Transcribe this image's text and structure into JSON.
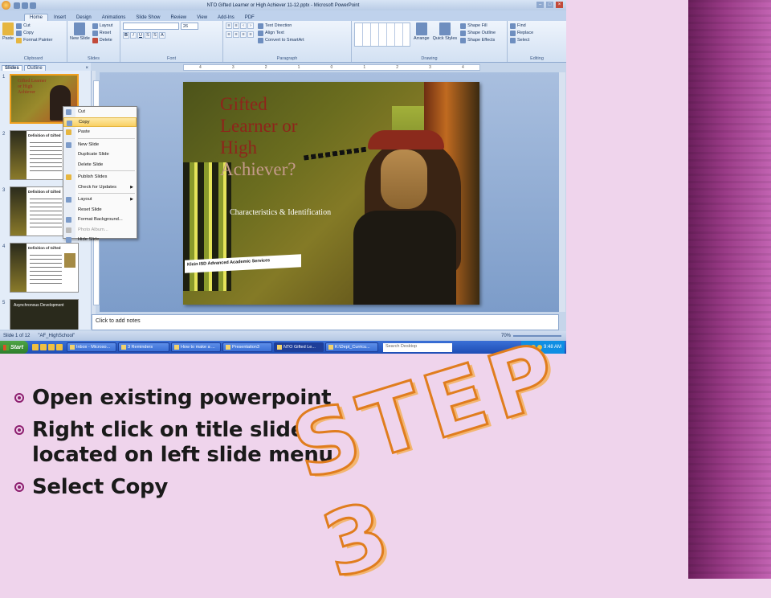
{
  "window": {
    "title": "NTO Gifted Learner or High Achiever 11-12.pptx - Microsoft PowerPoint"
  },
  "ribbon": {
    "tabs": [
      "Home",
      "Insert",
      "Design",
      "Animations",
      "Slide Show",
      "Review",
      "View",
      "Add-Ins",
      "PDF"
    ],
    "clipboard": {
      "paste": "Paste",
      "cut": "Cut",
      "copy": "Copy",
      "format_painter": "Format Painter",
      "label": "Clipboard"
    },
    "slides": {
      "new_slide": "New Slide",
      "layout": "Layout",
      "reset": "Reset",
      "delete": "Delete",
      "label": "Slides"
    },
    "font": {
      "size": "26",
      "label": "Font"
    },
    "paragraph": {
      "text_direction": "Text Direction",
      "align_text": "Align Text",
      "convert_smartart": "Convert to SmartArt",
      "label": "Paragraph"
    },
    "drawing": {
      "arrange": "Arrange",
      "quick_styles": "Quick Styles",
      "shape_fill": "Shape Fill",
      "shape_outline": "Shape Outline",
      "shape_effects": "Shape Effects",
      "label": "Drawing"
    },
    "editing": {
      "find": "Find",
      "replace": "Replace",
      "select": "Select",
      "label": "Editing"
    }
  },
  "pane": {
    "tab_slides": "Slides",
    "tab_outline": "Outline",
    "close": "×"
  },
  "thumbnails": {
    "t1": {
      "num": "1",
      "title": "Gifted Learner or High Achiever"
    },
    "t2": {
      "num": "2",
      "title": "Definition of Gifted"
    },
    "t3": {
      "num": "3",
      "title": "Definition of Gifted"
    },
    "t4": {
      "num": "4",
      "title": "Definition of Gifted"
    },
    "t5": {
      "num": "5",
      "title": "Asynchronous Development"
    }
  },
  "context_menu": {
    "cut": "Cut",
    "copy": "Copy",
    "paste": "Paste",
    "new_slide": "New Slide",
    "duplicate_slide": "Duplicate Slide",
    "delete_slide": "Delete Slide",
    "publish_slides": "Publish Slides",
    "check_updates": "Check for Updates",
    "layout": "Layout",
    "reset_slide": "Reset Slide",
    "format_background": "Format Background...",
    "photo_album": "Photo Album...",
    "hide_slide": "Hide Slide"
  },
  "slide": {
    "title_lines": [
      "Gifted",
      "Learner or",
      "High",
      "Achiever?"
    ],
    "subtitle": "Characteristics & Identification",
    "org": "Klein ISD Advanced Academic Services"
  },
  "notes": {
    "placeholder": "Click to add notes"
  },
  "status": {
    "slide": "Slide 1 of 12",
    "theme": "\"AF_HighSchool\"",
    "zoom": "70%"
  },
  "taskbar": {
    "start": "Start",
    "buttons": [
      "Inbox - Microso...",
      "3 Reminders",
      "How to make a ...",
      "Presentation3",
      "NTO Gifted Le...",
      "K:\\Dept_Curricu..."
    ],
    "search": "Search Desktop",
    "clock": "9:48 AM"
  },
  "bullets": [
    "Open existing powerpoint",
    "Right click on title slide, located on left slide menu",
    "Select Copy"
  ],
  "heading": "STEP 3",
  "colors": {
    "accent": "#8d1e6f",
    "step_outline": "#e07d1e",
    "background": "#efd4ec",
    "deco_bar": "#9a3b87"
  }
}
